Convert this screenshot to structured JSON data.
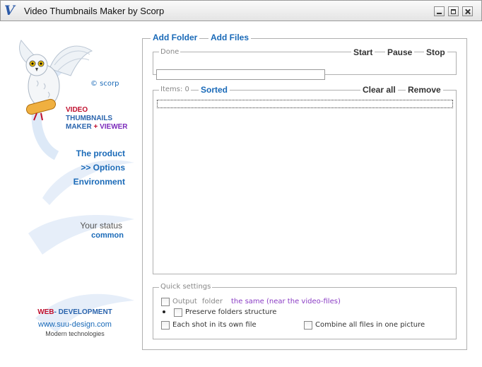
{
  "window": {
    "title": "Video Thumbnails Maker by Scorp",
    "app_icon": "V"
  },
  "sidebar": {
    "copyright": "© scorp",
    "brand": {
      "line1": "VIDEO",
      "line2": "THUMBNAILS",
      "line3a": "MAKER",
      "line3b": "+",
      "line3c": "VIEWER"
    },
    "nav": {
      "product": "The product",
      "options": ">> Options",
      "environment": "Environment"
    },
    "status": {
      "label": "Your status",
      "value": "common"
    },
    "footer": {
      "web": "WEB",
      "dash": "-",
      "development": "DEVELOPMENT",
      "site": "www.suu-design.com",
      "tagline": "Modern technologies"
    }
  },
  "toolbar": {
    "add_folder": "Add Folder",
    "add_files": "Add Files"
  },
  "progress_group": {
    "label": "Done",
    "start": "Start",
    "pause": "Pause",
    "stop": "Stop",
    "progress_fraction": 0
  },
  "list_group": {
    "items_label": "Items: 0",
    "sorted": "Sorted",
    "clear_all": "Clear all",
    "remove": "Remove"
  },
  "quick_settings": {
    "label": "Quick settings",
    "output_folder": "Output folder",
    "output_value": "the same (near the video-files)",
    "preserve": "Preserve folders structure",
    "each_shot": "Each shot in its own file",
    "combine": "Combine all files in one picture"
  },
  "colors": {
    "link_blue": "#1a6ab8",
    "brand_red": "#c0102e",
    "brand_purple": "#7b2bbb"
  }
}
